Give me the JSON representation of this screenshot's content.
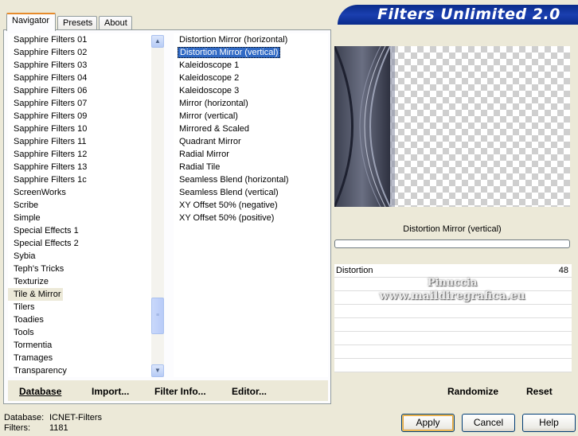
{
  "tabs": [
    "Navigator",
    "Presets",
    "About"
  ],
  "banner": "Filters Unlimited 2.0",
  "categories": [
    "Sapphire Filters 01",
    "Sapphire Filters 02",
    "Sapphire Filters 03",
    "Sapphire Filters 04",
    "Sapphire Filters 06",
    "Sapphire Filters 07",
    "Sapphire Filters 09",
    "Sapphire Filters 10",
    "Sapphire Filters 11",
    "Sapphire Filters 12",
    "Sapphire Filters 13",
    "Sapphire Filters 1c",
    "ScreenWorks",
    "Scribe",
    "Simple",
    "Special Effects 1",
    "Special Effects 2",
    "Sybia",
    "Teph's Tricks",
    "Texturize",
    "Tile & Mirror",
    "Tilers",
    "Toadies",
    "Tools",
    "Tormentia",
    "Tramages",
    "Transparency"
  ],
  "selected_category": "Tile & Mirror",
  "filters": [
    "Distortion Mirror (horizontal)",
    "Distortion Mirror (vertical)",
    "Kaleidoscope 1",
    "Kaleidoscope 2",
    "Kaleidoscope 3",
    "Mirror (horizontal)",
    "Mirror (vertical)",
    "Mirrored & Scaled",
    "Quadrant Mirror",
    "Radial Mirror",
    "Radial Tile",
    "Seamless Blend (horizontal)",
    "Seamless Blend (vertical)",
    "XY Offset 50% (negative)",
    "XY Offset 50% (positive)"
  ],
  "selected_filter": "Distortion Mirror (vertical)",
  "left_buttons": {
    "database": "Database",
    "import": "Import...",
    "filter_info": "Filter Info...",
    "editor": "Editor..."
  },
  "right_buttons": {
    "randomize": "Randomize",
    "reset": "Reset"
  },
  "preview": {
    "filter_name": "Distortion Mirror (vertical)"
  },
  "parameters": [
    {
      "label": "Distortion",
      "value": "48"
    }
  ],
  "watermark": {
    "line1": "Pinuccia",
    "line2": "www.maildiregrafica.eu"
  },
  "status": {
    "database_label": "Database:",
    "database_value": "ICNET-Filters",
    "filters_label": "Filters:",
    "filters_value": "1181"
  },
  "dialog_buttons": {
    "apply": "Apply",
    "cancel": "Cancel",
    "help": "Help"
  },
  "colors": {
    "selection": "#316ac5",
    "banner": "#0a2b8a",
    "tab_accent": "#e68b2c"
  }
}
